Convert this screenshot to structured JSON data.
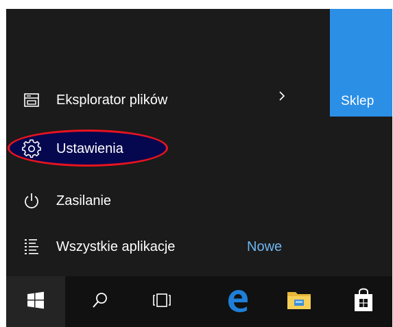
{
  "start_menu": {
    "items": [
      {
        "label": "Eksplorator plików",
        "icon": "file-explorer-icon",
        "has_submenu": true
      },
      {
        "label": "Ustawienia",
        "icon": "gear-icon",
        "highlighted": true
      },
      {
        "label": "Zasilanie",
        "icon": "power-icon"
      },
      {
        "label": "Wszystkie aplikacje",
        "icon": "all-apps-icon",
        "badge": "Nowe"
      }
    ],
    "tile": {
      "label": "Sklep",
      "color": "#2b8fe6"
    }
  },
  "taskbar": {
    "buttons": [
      "start-button",
      "search-button",
      "task-view-button",
      "edge-button",
      "file-explorer-button",
      "store-button"
    ]
  },
  "colors": {
    "menu_background": "#1b1b1b",
    "taskbar_background": "#111111",
    "highlight_outline": "#e8131f",
    "highlight_fill": "#06084f",
    "accent": "#6fb6f0",
    "edge_blue": "#1f7fd8"
  }
}
